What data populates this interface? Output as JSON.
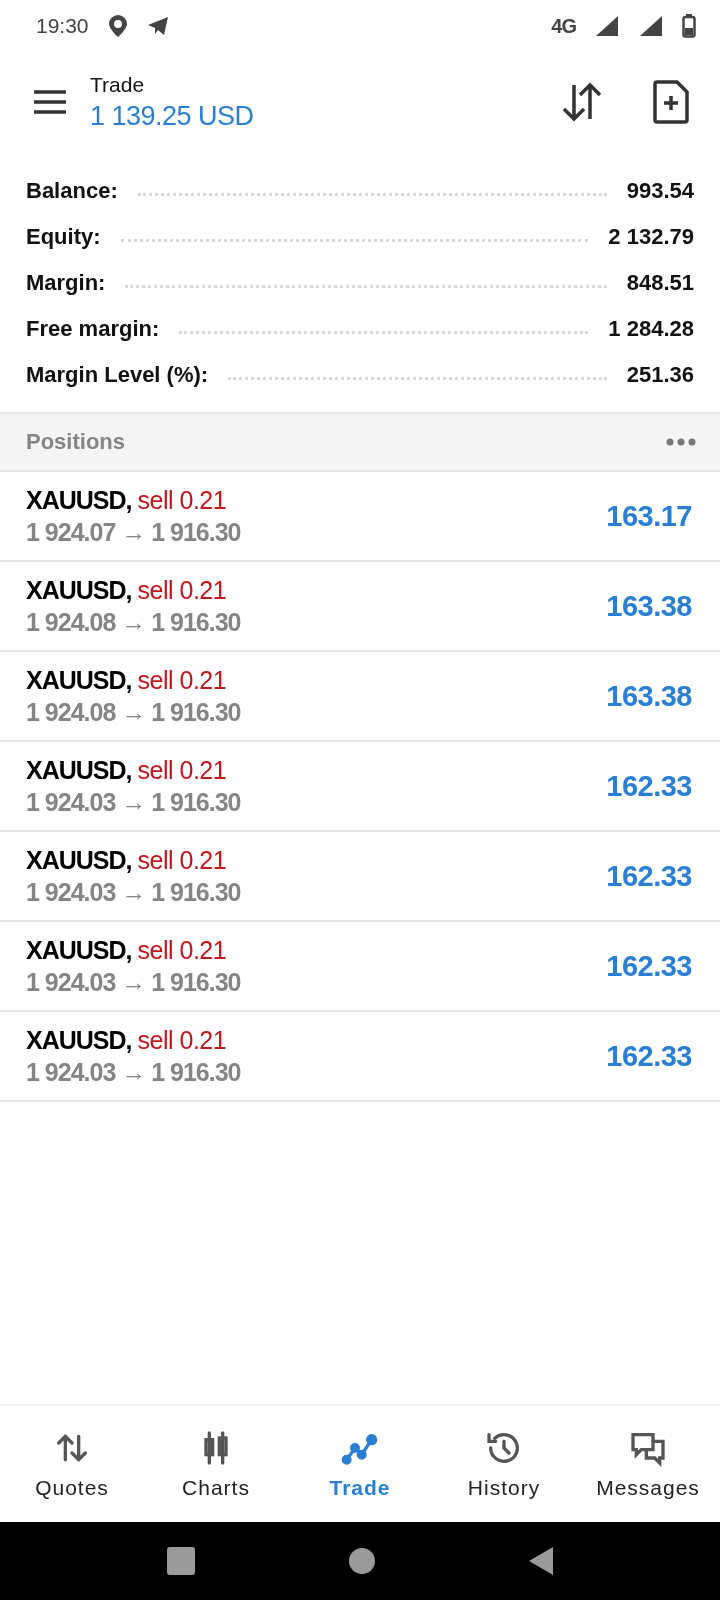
{
  "status_bar": {
    "time": "19:30",
    "network": "4G"
  },
  "header": {
    "title": "Trade",
    "subtitle": "1 139.25 USD"
  },
  "summary": [
    {
      "label": "Balance:",
      "value": "993.54"
    },
    {
      "label": "Equity:",
      "value": "2 132.79"
    },
    {
      "label": "Margin:",
      "value": "848.51"
    },
    {
      "label": "Free margin:",
      "value": "1 284.28"
    },
    {
      "label": "Margin Level (%):",
      "value": "251.36"
    }
  ],
  "positions": {
    "title": "Positions",
    "rows": [
      {
        "symbol": "XAUUSD,",
        "order": "sell 0.21",
        "prices": "1 924.07 → 1 916.30",
        "profit": "163.17"
      },
      {
        "symbol": "XAUUSD,",
        "order": "sell 0.21",
        "prices": "1 924.08 → 1 916.30",
        "profit": "163.38"
      },
      {
        "symbol": "XAUUSD,",
        "order": "sell 0.21",
        "prices": "1 924.08 → 1 916.30",
        "profit": "163.38"
      },
      {
        "symbol": "XAUUSD,",
        "order": "sell 0.21",
        "prices": "1 924.03 → 1 916.30",
        "profit": "162.33"
      },
      {
        "symbol": "XAUUSD,",
        "order": "sell 0.21",
        "prices": "1 924.03 → 1 916.30",
        "profit": "162.33"
      },
      {
        "symbol": "XAUUSD,",
        "order": "sell 0.21",
        "prices": "1 924.03 → 1 916.30",
        "profit": "162.33"
      },
      {
        "symbol": "XAUUSD,",
        "order": "sell 0.21",
        "prices": "1 924.03 → 1 916.30",
        "profit": "162.33"
      }
    ]
  },
  "bottom_nav": [
    {
      "label": "Quotes",
      "kind": "quotes",
      "selected": false
    },
    {
      "label": "Charts",
      "kind": "charts",
      "selected": false
    },
    {
      "label": "Trade",
      "kind": "trade",
      "selected": true
    },
    {
      "label": "History",
      "kind": "history",
      "selected": false
    },
    {
      "label": "Messages",
      "kind": "messages",
      "selected": false
    }
  ]
}
